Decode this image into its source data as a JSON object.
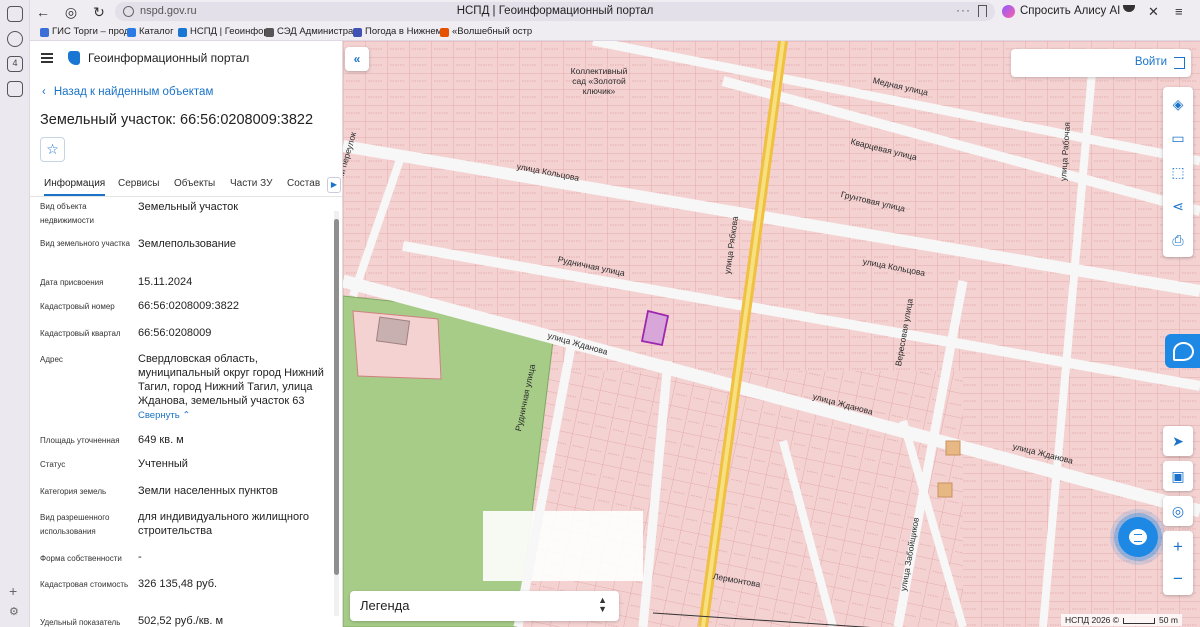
{
  "browser": {
    "url": "nspd.gov.ru",
    "tab_title": "НСПД | Геоинформационный портал",
    "alice_label": "Спросить Алису AI",
    "bookmarks": [
      {
        "label": "ГИС Торги – прод",
        "color": "#3b6fd8"
      },
      {
        "label": "Каталог",
        "color": "#2c7be5"
      },
      {
        "label": "НСПД | Геоинфор",
        "color": "#1976d2"
      },
      {
        "label": "СЭД Администрац",
        "color": "#555555"
      },
      {
        "label": "Погода в Нижнем",
        "color": "#3f51b5"
      },
      {
        "label": "«Волшебный остр",
        "color": "#e65100"
      }
    ]
  },
  "panel": {
    "portal_title": "Геоинформационный портал",
    "back_label": "Назад к найденным объектам",
    "object_title": "Земельный участок: 66:56:0208009:3822",
    "tabs": [
      "Информация",
      "Сервисы",
      "Объекты",
      "Части ЗУ",
      "Состав"
    ],
    "collapse_label": "Свернуть",
    "fields": [
      {
        "label": "Вид объекта недвижимости",
        "value": "Земельный участок"
      },
      {
        "label": "Вид земельного участка",
        "value": "Землепользование"
      },
      {
        "label": "Дата присвоения",
        "value": "15.11.2024"
      },
      {
        "label": "Кадастровый номер",
        "value": "66:56:0208009:3822"
      },
      {
        "label": "Кадастровый квартал",
        "value": "66:56:0208009"
      },
      {
        "label": "Адрес",
        "value": "Свердловская область, муниципальный округ город Нижний Тагил, город Нижний Тагил, улица Жданова, земельный участок 63"
      },
      {
        "label": "Площадь уточненная",
        "value": "649 кв. м"
      },
      {
        "label": "Статус",
        "value": "Учтенный"
      },
      {
        "label": "Категория земель",
        "value": "Земли населенных пунктов"
      },
      {
        "label": "Вид разрешенного использования",
        "value": "для индивидуального жилищного строительства"
      },
      {
        "label": "Форма собственности",
        "value": "-"
      },
      {
        "label": "Кадастровая стоимость",
        "value": "326 135,48 руб."
      },
      {
        "label": "Удельный показатель",
        "value": "502,52 руб./кв. м"
      }
    ]
  },
  "map": {
    "login_label": "Войти",
    "legend_label": "Легенда",
    "copyright": "НСПД 2026 ©",
    "scale_label": "50 m",
    "streets": [
      "Медная улица",
      "Кварцевая улица",
      "улица Кольцова",
      "Грунтовая улица",
      "улица Рябкова",
      "Малый переулок",
      "Рудничная улица",
      "улица Кольцова",
      "улица Жданова",
      "Рудничная улица",
      "улица Жданова",
      "Вересовая улица",
      "улица Жданова",
      "улица Рабочая",
      "Лермонтова",
      "улица Забойщиков"
    ],
    "place_label": "Коллективный сад «Золотой ключик»",
    "colors": {
      "parcel_fill": "#f4d2d2",
      "parcel_stroke": "#e0a0a0",
      "road": "#f7f7f7",
      "main_road": "#f0c040",
      "park": "#a6cc88",
      "selected": "#9c27b0"
    }
  }
}
